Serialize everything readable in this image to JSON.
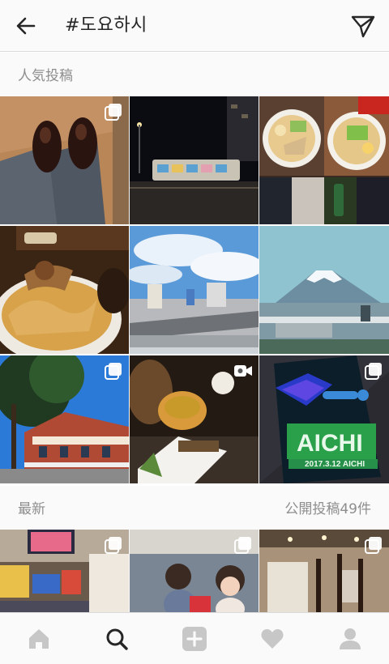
{
  "header": {
    "title": "#도요하시",
    "back_icon": "arrow-left-icon",
    "share_icon": "paper-plane-icon"
  },
  "top_posts": {
    "label": "人気投稿",
    "tiles": [
      {
        "scene": "leather-shoes",
        "badge": "multiple-photos-icon"
      },
      {
        "scene": "night-tram",
        "badge": ""
      },
      {
        "scene": "ramen-collage",
        "badge": ""
      },
      {
        "scene": "tempura-bowl",
        "badge": ""
      },
      {
        "scene": "city-sky",
        "badge": ""
      },
      {
        "scene": "mount-fuji",
        "badge": ""
      },
      {
        "scene": "red-building",
        "badge": "multiple-photos-icon"
      },
      {
        "scene": "tea-sushi",
        "badge": "video-camera-icon"
      },
      {
        "scene": "aichi-ticket",
        "badge": "multiple-photos-icon"
      }
    ]
  },
  "ticket": {
    "aichi": "AICHI",
    "date": "2017.3.12 AICHI"
  },
  "recent": {
    "label": "最新",
    "count": "公開投稿49件",
    "tiles": [
      {
        "scene": "playroom",
        "badge": "multiple-photos-icon"
      },
      {
        "scene": "children",
        "badge": "multiple-photos-icon"
      },
      {
        "scene": "interior",
        "badge": "multiple-photos-icon"
      }
    ]
  },
  "nav": {
    "items": [
      "home-icon",
      "search-icon",
      "add-post-icon",
      "heart-icon",
      "profile-icon"
    ],
    "active": "search-icon"
  }
}
